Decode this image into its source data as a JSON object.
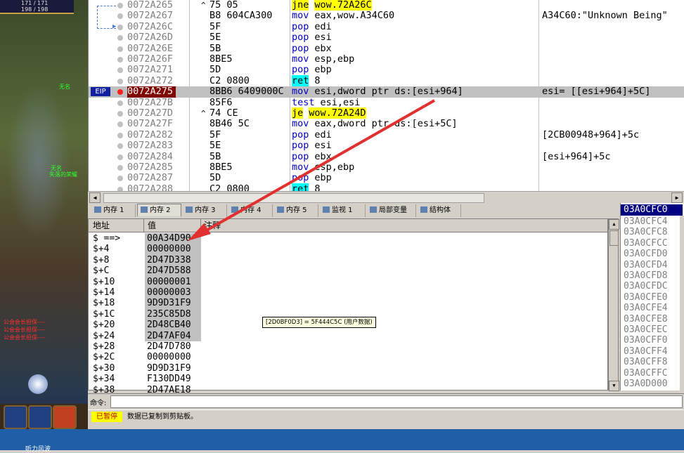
{
  "game": {
    "hud_line1": "171 / 171",
    "hud_line2": "198 / 198",
    "chat": [
      "公会会长担保----",
      "公会会长担保----",
      "公会会长担保----"
    ],
    "nameplate1": "无名",
    "nameplate2": "失落的荣耀",
    "taskbar_label": "听力风波"
  },
  "disasm": {
    "rows": [
      {
        "addr": "0072A265",
        "hex": "75 05",
        "asm_kw": "jne",
        "asm_rest": "wow.72A26C",
        "asm_hl": "yellow",
        "comment": "",
        "jump": "^"
      },
      {
        "addr": "0072A267",
        "hex": "B8 604CA300",
        "asm_kw": "mov",
        "asm_rest": "eax,wow.A34C60",
        "asm_hl": "",
        "comment": "A34C60:\"Unknown Being\"",
        "jump": ""
      },
      {
        "addr": "0072A26C",
        "hex": "5F",
        "asm_kw": "pop",
        "asm_rest": "edi",
        "asm_hl": "",
        "comment": "",
        "jump": ""
      },
      {
        "addr": "0072A26D",
        "hex": "5E",
        "asm_kw": "pop",
        "asm_rest": "esi",
        "asm_hl": "",
        "comment": "",
        "jump": ""
      },
      {
        "addr": "0072A26E",
        "hex": "5B",
        "asm_kw": "pop",
        "asm_rest": "ebx",
        "asm_hl": "",
        "comment": "",
        "jump": ""
      },
      {
        "addr": "0072A26F",
        "hex": "8BE5",
        "asm_kw": "mov",
        "asm_rest": "esp,ebp",
        "asm_hl": "",
        "comment": "",
        "jump": ""
      },
      {
        "addr": "0072A271",
        "hex": "5D",
        "asm_kw": "pop",
        "asm_rest": "ebp",
        "asm_hl": "",
        "comment": "",
        "jump": ""
      },
      {
        "addr": "0072A272",
        "hex": "C2 0800",
        "asm_kw": "ret",
        "asm_rest": "8",
        "asm_hl": "cyan",
        "comment": "",
        "jump": ""
      },
      {
        "addr": "0072A275",
        "hex": "8BB6 6409000C",
        "asm_kw": "mov",
        "asm_rest": "esi,dword ptr ds:[esi+964]",
        "asm_hl": "",
        "comment": "esi= [[esi+964]+5C]",
        "jump": ""
      },
      {
        "addr": "0072A27B",
        "hex": "85F6",
        "asm_kw": "test",
        "asm_rest": "esi,esi",
        "asm_hl": "",
        "comment": "",
        "jump": ""
      },
      {
        "addr": "0072A27D",
        "hex": "74 CE",
        "asm_kw": "je",
        "asm_rest": "wow.72A24D",
        "asm_hl": "yellow",
        "comment": "",
        "jump": "^"
      },
      {
        "addr": "0072A27F",
        "hex": "8B46 5C",
        "asm_kw": "mov",
        "asm_rest": "eax,dword ptr ds:[esi+5C]",
        "asm_hl": "",
        "comment": "",
        "jump": ""
      },
      {
        "addr": "0072A282",
        "hex": "5F",
        "asm_kw": "pop",
        "asm_rest": "edi",
        "asm_hl": "",
        "comment": "[2CB00948+964]+5c",
        "jump": ""
      },
      {
        "addr": "0072A283",
        "hex": "5E",
        "asm_kw": "pop",
        "asm_rest": "esi",
        "asm_hl": "",
        "comment": "",
        "jump": ""
      },
      {
        "addr": "0072A284",
        "hex": "5B",
        "asm_kw": "pop",
        "asm_rest": "ebx",
        "asm_hl": "",
        "comment": "[esi+964]+5c",
        "jump": ""
      },
      {
        "addr": "0072A285",
        "hex": "8BE5",
        "asm_kw": "mov",
        "asm_rest": "esp,ebp",
        "asm_hl": "",
        "comment": "",
        "jump": ""
      },
      {
        "addr": "0072A287",
        "hex": "5D",
        "asm_kw": "pop",
        "asm_rest": "ebp",
        "asm_hl": "",
        "comment": "",
        "jump": ""
      },
      {
        "addr": "0072A288",
        "hex": "C2 0800",
        "asm_kw": "ret",
        "asm_rest": "8",
        "asm_hl": "cyan",
        "comment": "",
        "jump": ""
      }
    ],
    "eip_label": "EIP",
    "eip_index": 8
  },
  "tabs": [
    {
      "label": "内存 1"
    },
    {
      "label": "内存 2"
    },
    {
      "label": "内存 3"
    },
    {
      "label": "内存 4"
    },
    {
      "label": "内存 5"
    },
    {
      "label": "监视 1"
    },
    {
      "label": "局部变量"
    },
    {
      "label": "结构体"
    }
  ],
  "dump": {
    "col_addr": "地址",
    "col_value": "值",
    "col_comment": "注释",
    "rows": [
      {
        "a": "$ ==>",
        "v": "00A34D90"
      },
      {
        "a": "$+4",
        "v": "00000000"
      },
      {
        "a": "$+8",
        "v": "2D47D338"
      },
      {
        "a": "$+C",
        "v": "2D47D588"
      },
      {
        "a": "$+10",
        "v": "00000001"
      },
      {
        "a": "$+14",
        "v": "00000003"
      },
      {
        "a": "$+18",
        "v": "9D9D31F9"
      },
      {
        "a": "$+1C",
        "v": "235C85D8"
      },
      {
        "a": "$+20",
        "v": "2D48CB40"
      },
      {
        "a": "$+24",
        "v": "2D47AF04"
      },
      {
        "a": "$+28",
        "v": "2D47D780"
      },
      {
        "a": "$+2C",
        "v": "00000000"
      },
      {
        "a": "$+30",
        "v": "9D9D31F9"
      },
      {
        "a": "$+34",
        "v": "F130DD49"
      },
      {
        "a": "$+38",
        "v": "2D47AE18"
      }
    ],
    "selected_count": 10,
    "tooltip": "[2D0BF0D3] = 5F444C5C (用户数据)"
  },
  "stack": {
    "header": "03A0CFC0",
    "rows": [
      "03A0CFC4",
      "03A0CFC8",
      "03A0CFCC",
      "03A0CFD0",
      "03A0CFD4",
      "03A0CFD8",
      "03A0CFDC",
      "03A0CFE0",
      "03A0CFE4",
      "03A0CFE8",
      "03A0CFEC",
      "03A0CFF0",
      "03A0CFF4",
      "03A0CFF8",
      "03A0CFFC",
      "03A0D000"
    ]
  },
  "command": {
    "label": "命令:",
    "value": ""
  },
  "status": {
    "state": "已暂停",
    "message": "数据已复制到剪贴板。"
  },
  "colors": {
    "eip_bg": "#1020a0",
    "hl_yellow": "#ffff00",
    "hl_cyan": "#00ffff",
    "arrow": "#e03030"
  }
}
